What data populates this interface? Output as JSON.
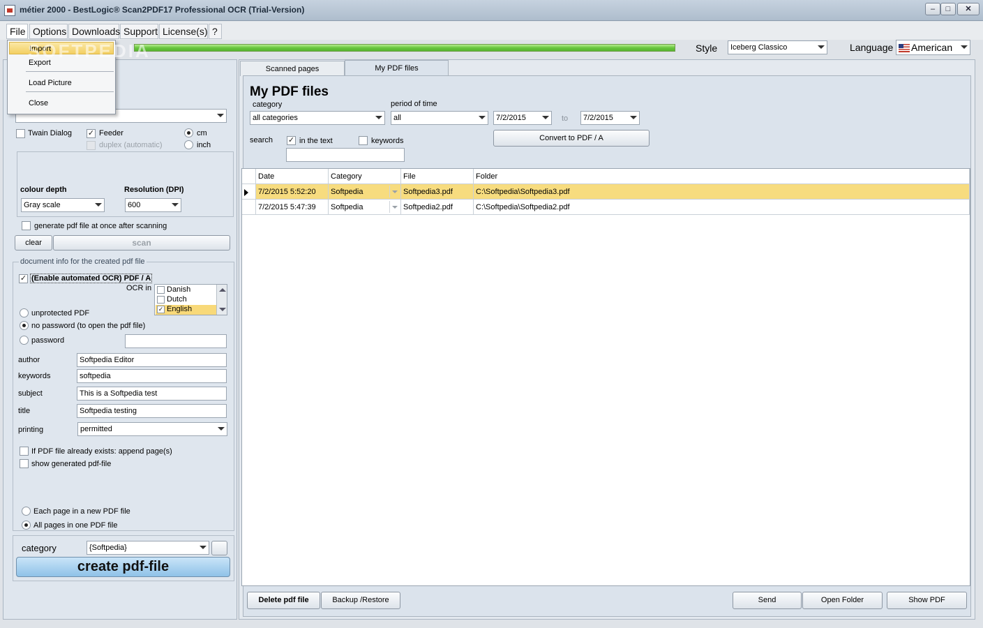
{
  "window": {
    "title": "métier 2000 - BestLogic® Scan2PDF17 Professional OCR (Trial-Version)",
    "minimize": "–",
    "maximize": "□",
    "close": "✕"
  },
  "menu": {
    "items": [
      "File",
      "Options",
      "Downloads",
      "Support",
      "License(s)",
      "?"
    ],
    "file_menu": [
      "Import",
      "Export",
      "Load Picture",
      "Close"
    ],
    "watermark": "SOFTPEDIA"
  },
  "top": {
    "style_label": "Style",
    "style_value": "Iceberg Classico",
    "language_label": "Language",
    "language_value": "American"
  },
  "left": {
    "twain": "Twain Dialog",
    "feeder": "Feeder",
    "duplex": "duplex (automatic)",
    "cm": "cm",
    "inch": "inch",
    "colour_depth_label": "colour depth",
    "colour_depth_value": "Gray scale",
    "resolution_label": "Resolution (DPI)",
    "resolution_value": "600",
    "generate_pdf": "generate pdf file at once after scanning",
    "clear": "clear",
    "scan": "scan",
    "doc_info_caption": "document info for the created pdf file",
    "enable_ocr": "(Enable automated OCR) PDF / A",
    "ocr_in": "OCR in",
    "ocr_languages": [
      "Danish",
      "Dutch",
      "English"
    ],
    "unprotected": "unprotected PDF",
    "no_password": "no password (to open the pdf file)",
    "password": "password",
    "author_label": "author",
    "author_value": "Softpedia Editor",
    "keywords_label": "keywords",
    "keywords_value": "softpedia",
    "subject_label": "subject",
    "subject_value": "This is a Softpedia test",
    "title_label": "title",
    "title_value": "Softpedia testing",
    "printing_label": "printing",
    "printing_value": "permitted",
    "append": "If PDF file already exists: append page(s)",
    "show_generated": "show generated pdf-file",
    "each_page": "Each page in a new PDF file",
    "all_pages": "All pages in one PDF file",
    "category_label": "category",
    "category_value": "{Softpedia}",
    "create": "create pdf-file"
  },
  "right": {
    "tabs": [
      "Scanned pages",
      "My PDF files"
    ],
    "heading": "My PDF files",
    "category_label": "category",
    "category_value": "all categories",
    "period_label": "period of time",
    "period_value": "all",
    "date_from": "7/2/2015",
    "to": "to",
    "date_to": "7/2/2015",
    "search_label": "search",
    "in_text": "in the text",
    "keywords": "keywords",
    "convert": "Convert to PDF / A",
    "columns": [
      "Date",
      "Category",
      "File",
      "Folder"
    ],
    "rows": [
      {
        "date": "7/2/2015 5:52:20",
        "category": "Softpedia",
        "file": "Softpedia3.pdf",
        "folder": "C:\\Softpedia\\Softpedia3.pdf"
      },
      {
        "date": "7/2/2015 5:47:39",
        "category": "Softpedia",
        "file": "Softpedia2.pdf",
        "folder": "C:\\Softpedia\\Softpedia2.pdf"
      }
    ],
    "delete": "Delete pdf file",
    "backup": "Backup /Restore",
    "send": "Send",
    "open_folder": "Open Folder",
    "show_pdf": "Show PDF"
  }
}
